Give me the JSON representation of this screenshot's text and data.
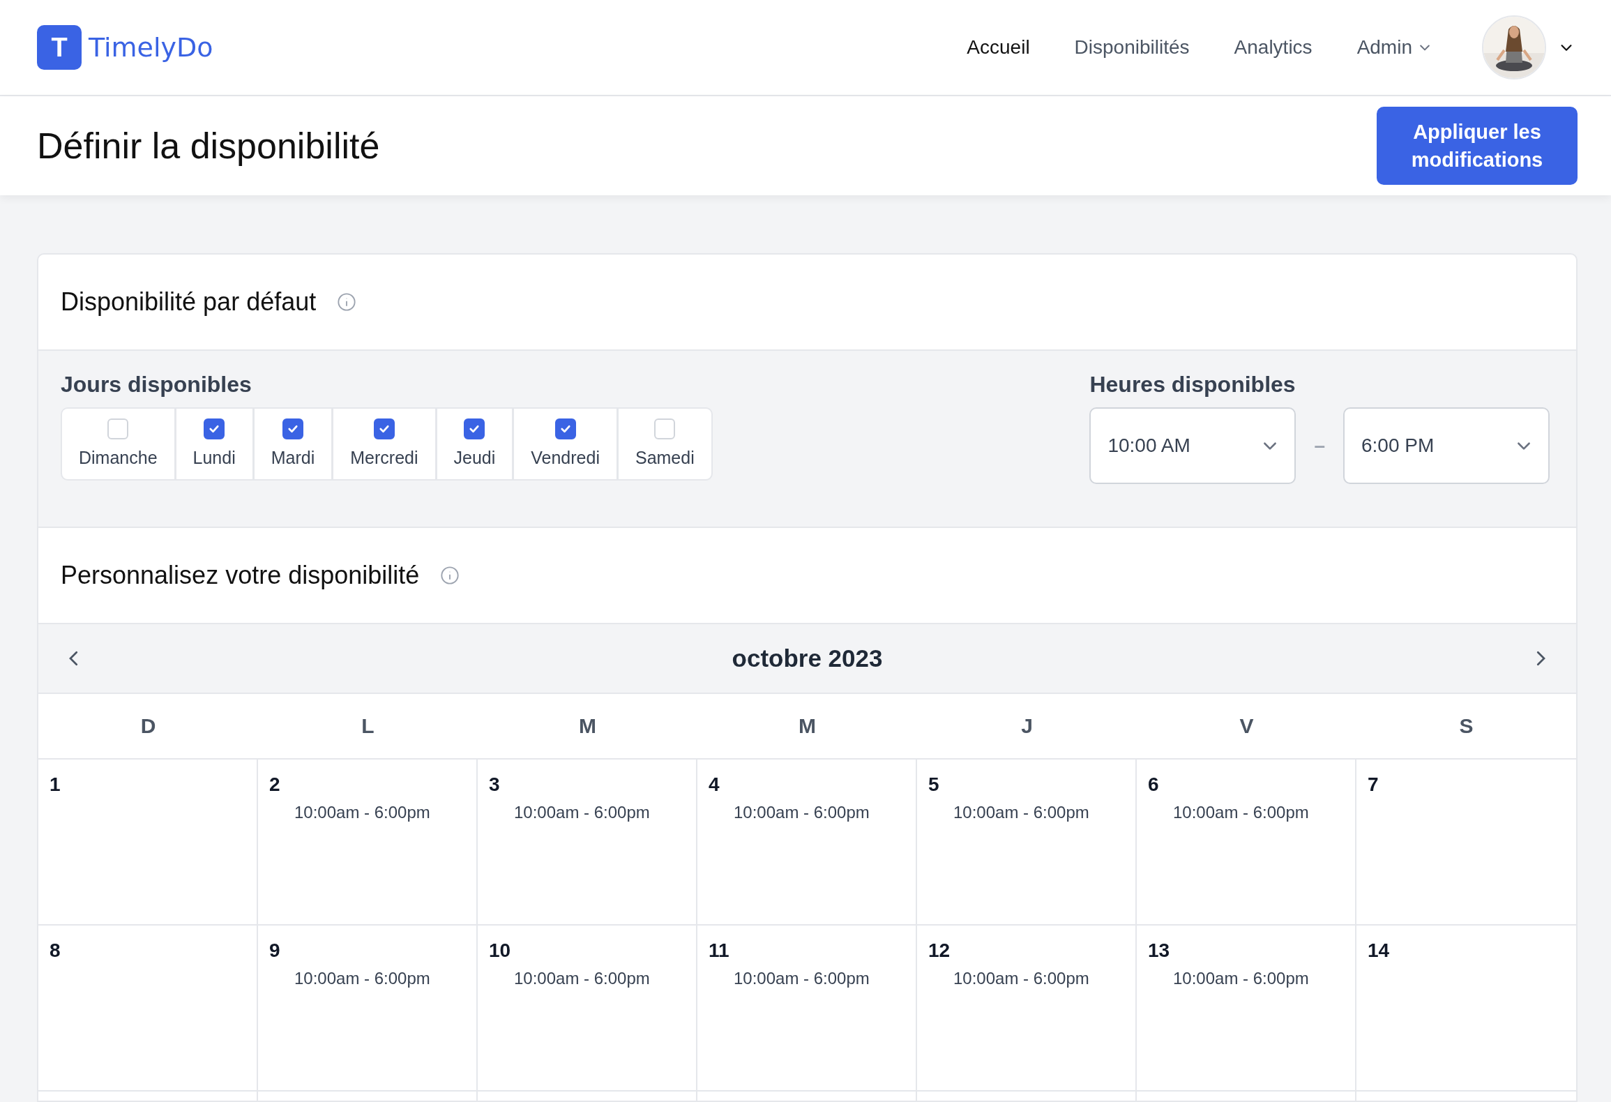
{
  "brand": {
    "logo_letter": "T",
    "name": "TimelyDo"
  },
  "nav": [
    {
      "label": "Accueil",
      "selected": true
    },
    {
      "label": "Disponibilités",
      "selected": false
    },
    {
      "label": "Analytics",
      "selected": false
    },
    {
      "label": "Admin",
      "selected": false,
      "dropdown": true
    }
  ],
  "page_title": "Définir la disponibilité",
  "apply_button": "Appliquer les modifications",
  "default_section": {
    "title": "Disponibilité par défaut",
    "days_label": "Jours disponibles",
    "days": [
      {
        "label": "Dimanche",
        "checked": false
      },
      {
        "label": "Lundi",
        "checked": true
      },
      {
        "label": "Mardi",
        "checked": true
      },
      {
        "label": "Mercredi",
        "checked": true
      },
      {
        "label": "Jeudi",
        "checked": true
      },
      {
        "label": "Vendredi",
        "checked": true
      },
      {
        "label": "Samedi",
        "checked": false
      }
    ],
    "hours_label": "Heures disponibles",
    "start": "10:00 AM",
    "separator": "–",
    "end": "6:00 PM"
  },
  "custom_section": {
    "title": "Personnalisez votre disponibilité"
  },
  "calendar": {
    "month": "octobre 2023",
    "weekdays": [
      "D",
      "L",
      "M",
      "M",
      "J",
      "V",
      "S"
    ],
    "weeks": [
      [
        {
          "day": "1"
        },
        {
          "day": "2",
          "hours": "10:00am - 6:00pm"
        },
        {
          "day": "3",
          "hours": "10:00am - 6:00pm"
        },
        {
          "day": "4",
          "hours": "10:00am - 6:00pm"
        },
        {
          "day": "5",
          "hours": "10:00am - 6:00pm"
        },
        {
          "day": "6",
          "hours": "10:00am - 6:00pm"
        },
        {
          "day": "7"
        }
      ],
      [
        {
          "day": "8"
        },
        {
          "day": "9",
          "hours": "10:00am - 6:00pm"
        },
        {
          "day": "10",
          "hours": "10:00am - 6:00pm"
        },
        {
          "day": "11",
          "hours": "10:00am - 6:00pm"
        },
        {
          "day": "12",
          "hours": "10:00am - 6:00pm"
        },
        {
          "day": "13",
          "hours": "10:00am - 6:00pm"
        },
        {
          "day": "14"
        }
      ]
    ]
  }
}
